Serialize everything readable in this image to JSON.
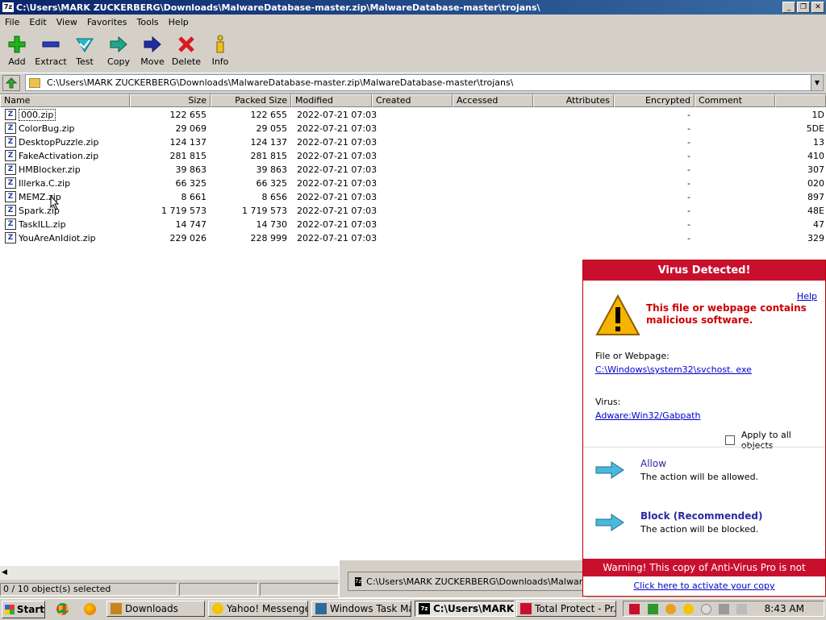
{
  "window": {
    "title": "C:\\Users\\MARK ZUCKERBERG\\Downloads\\MalwareDatabase-master.zip\\MalwareDatabase-master\\trojans\\",
    "app_icon": "7z"
  },
  "menu": [
    "File",
    "Edit",
    "View",
    "Favorites",
    "Tools",
    "Help"
  ],
  "toolbar": {
    "add": "Add",
    "extract": "Extract",
    "test": "Test",
    "copy": "Copy",
    "move": "Move",
    "delete": "Delete",
    "info": "Info"
  },
  "address": {
    "path": "C:\\Users\\MARK ZUCKERBERG\\Downloads\\MalwareDatabase-master.zip\\MalwareDatabase-master\\trojans\\"
  },
  "columns": {
    "name": "Name",
    "size": "Size",
    "packed": "Packed Size",
    "modified": "Modified",
    "created": "Created",
    "accessed": "Accessed",
    "attributes": "Attributes",
    "encrypted": "Encrypted",
    "comment": "Comment"
  },
  "files": [
    {
      "name": "000.zip",
      "size": "122 655",
      "packed": "122 655",
      "modified": "2022-07-21 07:03",
      "encrypted": "-",
      "crc": "1D"
    },
    {
      "name": "ColorBug.zip",
      "size": "29 069",
      "packed": "29 055",
      "modified": "2022-07-21 07:03",
      "encrypted": "-",
      "crc": "5DE"
    },
    {
      "name": "DesktopPuzzle.zip",
      "size": "124 137",
      "packed": "124 137",
      "modified": "2022-07-21 07:03",
      "encrypted": "-",
      "crc": "13"
    },
    {
      "name": "FakeActivation.zip",
      "size": "281 815",
      "packed": "281 815",
      "modified": "2022-07-21 07:03",
      "encrypted": "-",
      "crc": "410"
    },
    {
      "name": "HMBlocker.zip",
      "size": "39 863",
      "packed": "39 863",
      "modified": "2022-07-21 07:03",
      "encrypted": "-",
      "crc": "307"
    },
    {
      "name": "Illerka.C.zip",
      "size": "66 325",
      "packed": "66 325",
      "modified": "2022-07-21 07:03",
      "encrypted": "-",
      "crc": "020"
    },
    {
      "name": "MEMZ.zip",
      "size": "8 661",
      "packed": "8 656",
      "modified": "2022-07-21 07:03",
      "encrypted": "-",
      "crc": "897"
    },
    {
      "name": "Spark.zip",
      "size": "1 719 573",
      "packed": "1 719 573",
      "modified": "2022-07-21 07:03",
      "encrypted": "-",
      "crc": "48E"
    },
    {
      "name": "TaskILL.zip",
      "size": "14 747",
      "packed": "14 730",
      "modified": "2022-07-21 07:03",
      "encrypted": "-",
      "crc": "47"
    },
    {
      "name": "YouAreAnIdiot.zip",
      "size": "229 026",
      "packed": "228 999",
      "modified": "2022-07-21 07:03",
      "encrypted": "-",
      "crc": "329"
    }
  ],
  "status": {
    "selected": "0 / 10 object(s) selected"
  },
  "bottom_window": {
    "title": "C:\\Users\\MARK ZUCKERBERG\\Downloads\\MalwareDatabase-master.zip"
  },
  "popup": {
    "title": "Virus Detected!",
    "help": "Help",
    "message": "This file or webpage contains malicious software.",
    "file_label": "File or Webpage:",
    "file_link": " C:\\Windows\\system32\\svchost. exe",
    "virus_label": "Virus:",
    "virus_link": "Adware:Win32/Gabpath",
    "apply_all": "Apply to all objects",
    "allow_title": "Allow",
    "allow_desc": "The action will be allowed.",
    "block_title": "Block (Recommended)",
    "block_desc": "The action will be blocked.",
    "warning": "Warning! This copy of Anti-Virus Pro is not activated.",
    "activate": "Click here to activate your copy",
    "accent": "#c8102e"
  },
  "taskbar": {
    "start": "Start",
    "tasks": [
      "Downloads",
      "Yahoo! Messenger",
      "Windows Task Ma...",
      "C:\\Users\\MARK...",
      "Total Protect - Pr..."
    ],
    "clock": "8:43 AM"
  }
}
